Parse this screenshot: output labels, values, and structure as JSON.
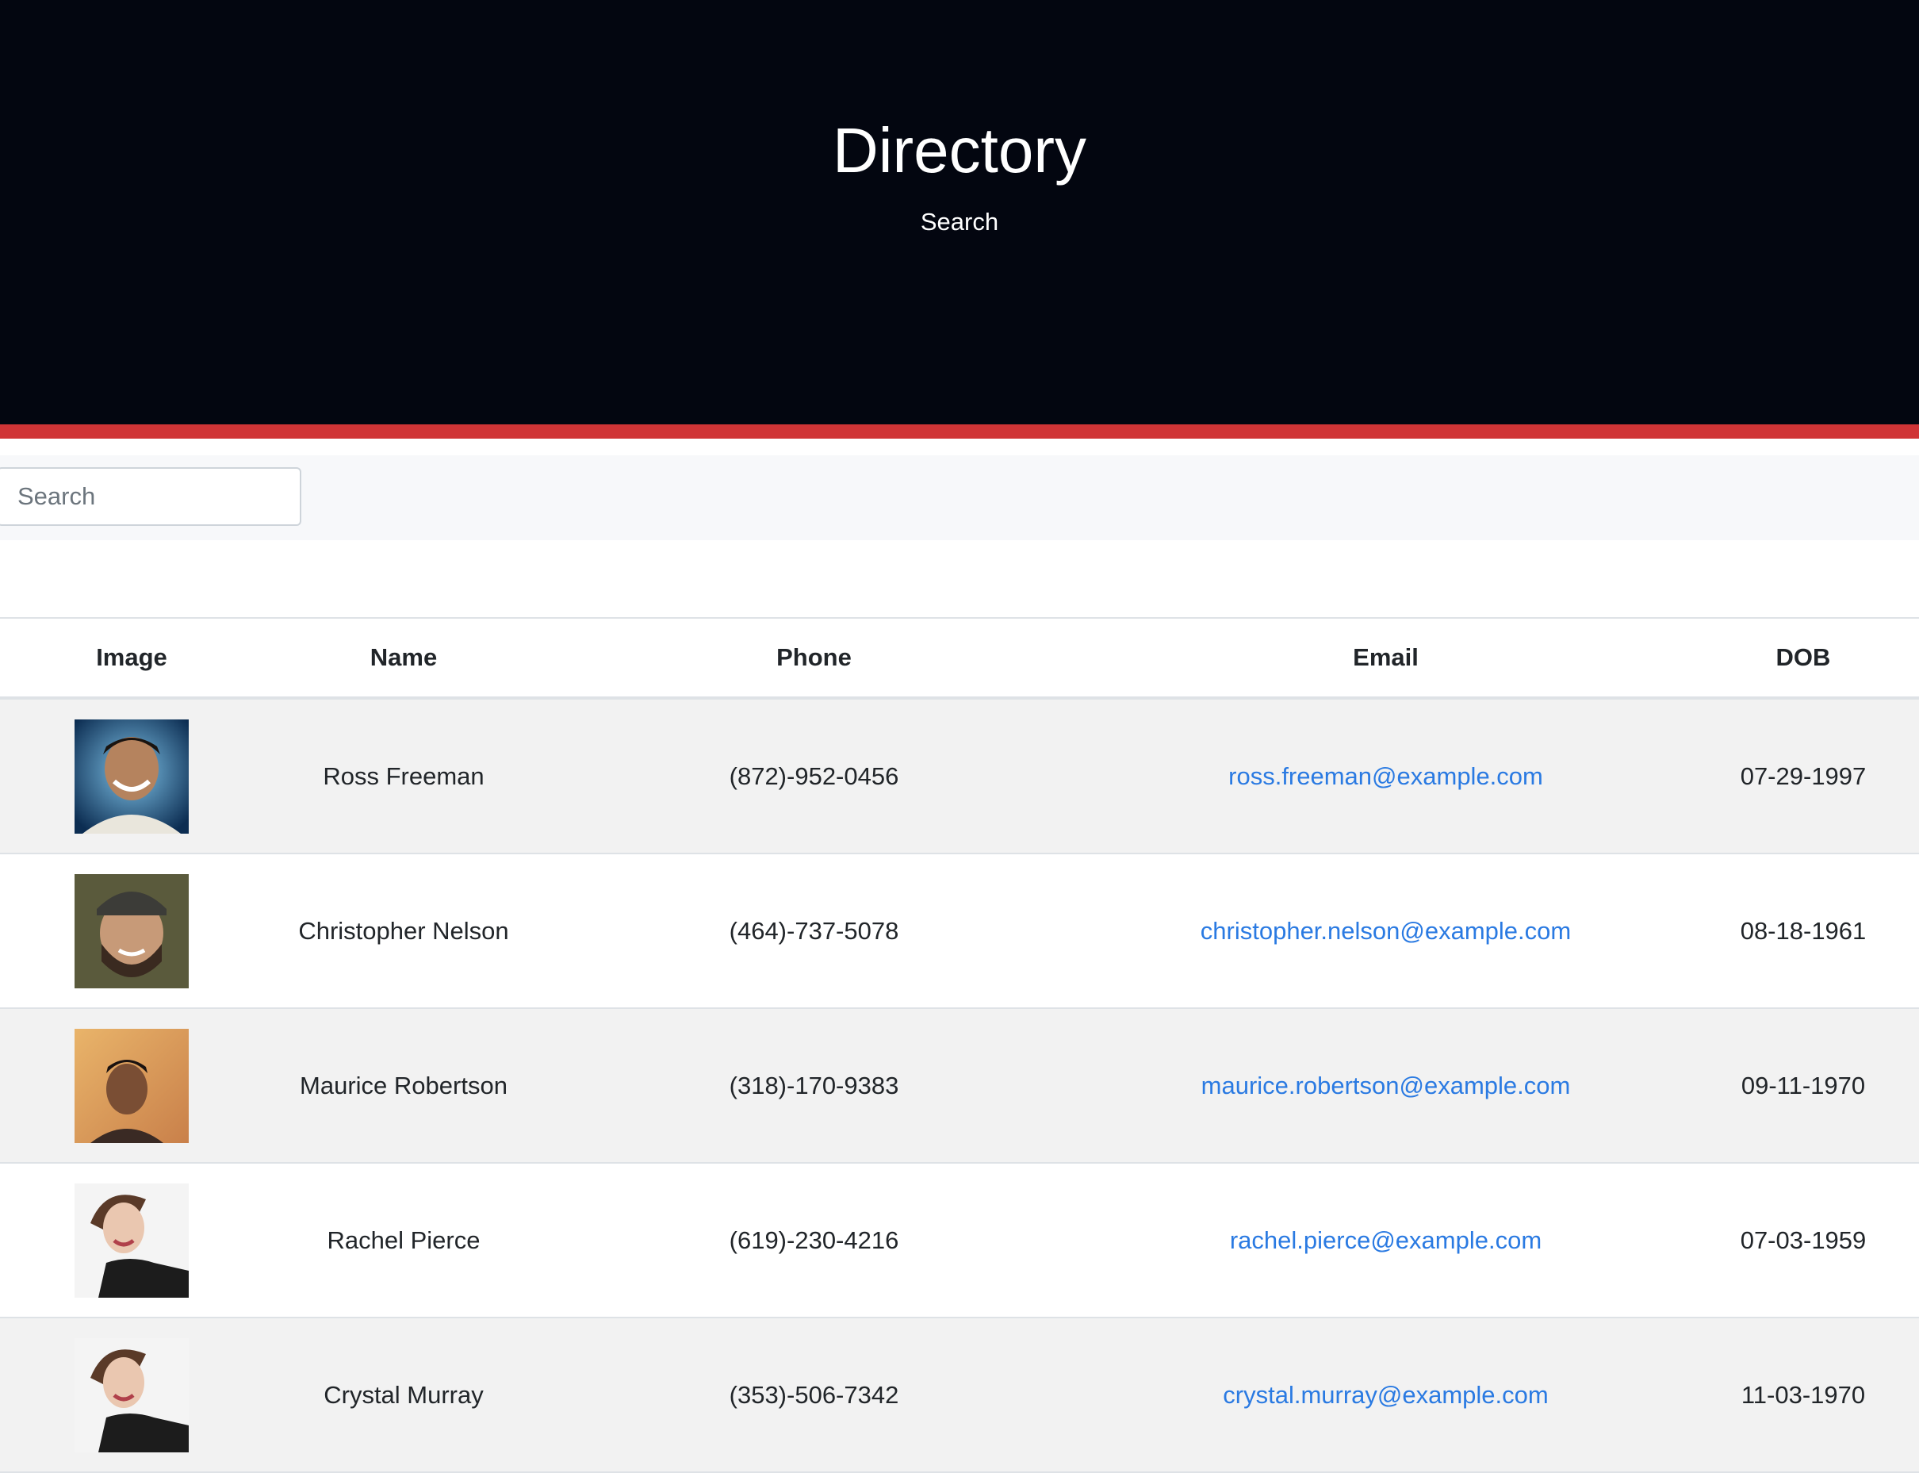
{
  "header": {
    "title": "Directory",
    "subtitle": "Search"
  },
  "search": {
    "placeholder": "Search"
  },
  "table": {
    "columns": [
      "Image",
      "Name",
      "Phone",
      "Email",
      "DOB"
    ],
    "rows": [
      {
        "name": "Ross Freeman",
        "phone": "(872)-952-0456",
        "email": "ross.freeman@example.com",
        "dob": "07-29-1997"
      },
      {
        "name": "Christopher Nelson",
        "phone": "(464)-737-5078",
        "email": "christopher.nelson@example.com",
        "dob": "08-18-1961"
      },
      {
        "name": "Maurice Robertson",
        "phone": "(318)-170-9383",
        "email": "maurice.robertson@example.com",
        "dob": "09-11-1970"
      },
      {
        "name": "Rachel Pierce",
        "phone": "(619)-230-4216",
        "email": "rachel.pierce@example.com",
        "dob": "07-03-1959"
      },
      {
        "name": "Crystal Murray",
        "phone": "(353)-506-7342",
        "email": "crystal.murray@example.com",
        "dob": "11-03-1970"
      }
    ]
  },
  "colors": {
    "header_bg": "#030610",
    "accent_bar": "#d03436",
    "link": "#2a7ae2",
    "striped_row": "#f2f2f2"
  }
}
